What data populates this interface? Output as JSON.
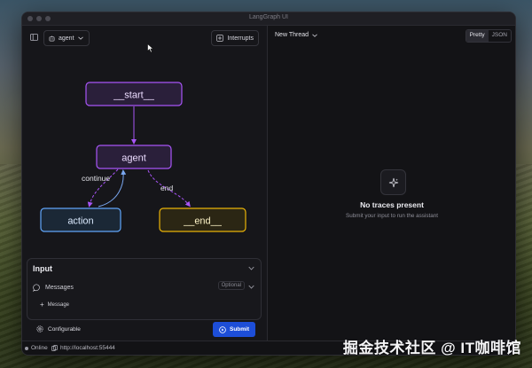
{
  "window": {
    "title": "LangGraph UI"
  },
  "toolbar": {
    "agent_label": "agent",
    "interrupts_label": "Interrupts"
  },
  "graph": {
    "nodes": {
      "start": "__start__",
      "agent": "agent",
      "action": "action",
      "end": "__end__"
    },
    "edges": {
      "continue": "continue",
      "end": "end"
    }
  },
  "input": {
    "title": "Input",
    "messages_label": "Messages",
    "optional_badge": "Optional",
    "add_message_label": "Message",
    "configurable_label": "Configurable",
    "submit_label": "Submit"
  },
  "thread": {
    "label": "New Thread"
  },
  "view_toggle": {
    "pretty": "Pretty",
    "json": "JSON",
    "active": "Pretty"
  },
  "empty_state": {
    "title": "No traces present",
    "subtitle": "Submit your input to run the assistant"
  },
  "status": {
    "online": "Online",
    "host": "http://localhost:55444"
  },
  "overlay": {
    "watermark": "掘金技术社区 @ IT咖啡馆"
  },
  "colors": {
    "start_border": "#a855f7",
    "agent_border": "#a855f7",
    "action_border": "#60a5fa",
    "end_border": "#eab308",
    "accent": "#1d4ed8"
  }
}
